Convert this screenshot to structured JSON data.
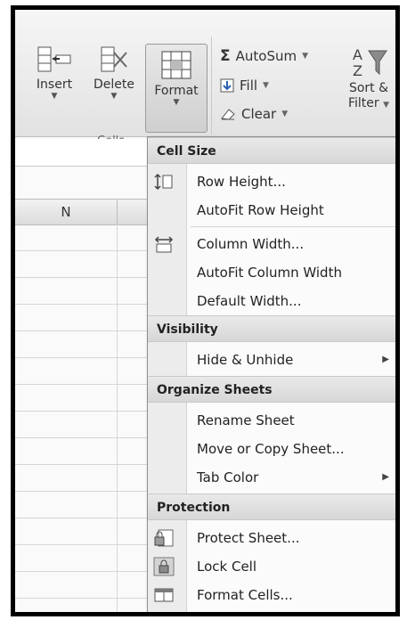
{
  "ribbon": {
    "insert_label": "Insert",
    "delete_label": "Delete",
    "format_label": "Format",
    "cells_group_label": "Cells",
    "autosum_label": "AutoSum",
    "fill_label": "Fill",
    "clear_label": "Clear",
    "sort_label_line1": "Sort &",
    "sort_label_line2": "Filter"
  },
  "sheet": {
    "column_n": "N"
  },
  "menu": {
    "sections": [
      {
        "header": "Cell Size",
        "items": [
          "Row Height...",
          "AutoFit Row Height",
          "Column Width...",
          "AutoFit Column Width",
          "Default Width..."
        ]
      },
      {
        "header": "Visibility",
        "items": [
          "Hide & Unhide"
        ]
      },
      {
        "header": "Organize Sheets",
        "items": [
          "Rename Sheet",
          "Move or Copy Sheet...",
          "Tab Color"
        ]
      },
      {
        "header": "Protection",
        "items": [
          "Protect Sheet...",
          "Lock Cell",
          "Format Cells..."
        ]
      }
    ]
  },
  "icons": {
    "row_height": "row-height-icon",
    "column_width": "column-width-icon",
    "protect_sheet": "protect-sheet-icon",
    "lock_cell": "lock-cell-icon",
    "format_cells": "format-cells-icon"
  },
  "colors": {
    "frame": "#000000",
    "menu_header": "#dcdcdc",
    "ribbon": "#e8e8e8"
  }
}
